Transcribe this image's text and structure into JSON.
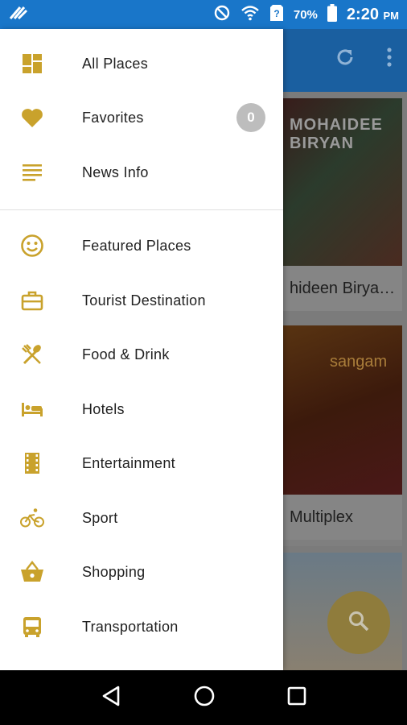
{
  "status_bar": {
    "battery": "70%",
    "time": "2:20",
    "ampm": "PM"
  },
  "colors": {
    "accent": "#c9a22c",
    "status_bar": "#1976c9"
  },
  "drawer": {
    "section1": [
      {
        "label": "All Places",
        "icon": "dashboard-icon"
      },
      {
        "label": "Favorites",
        "icon": "heart-icon",
        "badge": "0"
      },
      {
        "label": "News Info",
        "icon": "list-icon"
      }
    ],
    "section2": [
      {
        "label": "Featured Places",
        "icon": "smiley-icon"
      },
      {
        "label": "Tourist Destination",
        "icon": "briefcase-icon"
      },
      {
        "label": "Food & Drink",
        "icon": "utensils-icon"
      },
      {
        "label": "Hotels",
        "icon": "bed-icon"
      },
      {
        "label": "Entertainment",
        "icon": "film-icon"
      },
      {
        "label": "Sport",
        "icon": "bicycle-icon"
      },
      {
        "label": "Shopping",
        "icon": "basket-icon"
      },
      {
        "label": "Transportation",
        "icon": "bus-icon"
      }
    ]
  },
  "background": {
    "cards": [
      {
        "title": "hideen Birya…",
        "image_text": "MOHAIDEE BIRYAN"
      },
      {
        "title": "Multiplex",
        "image_text": "sangam"
      }
    ]
  }
}
